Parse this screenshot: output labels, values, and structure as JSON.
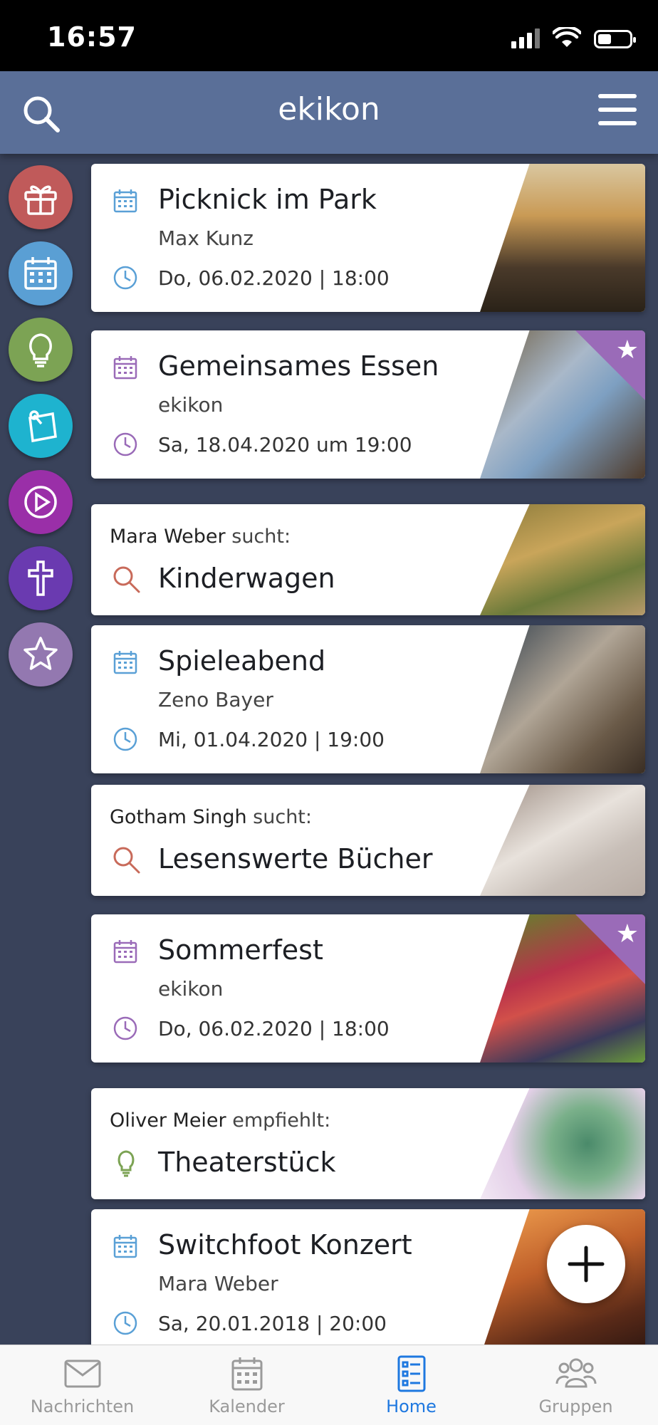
{
  "status_bar": {
    "time": "16:57"
  },
  "header": {
    "title": "ekikon"
  },
  "rail": [
    {
      "name": "gift",
      "color": "#c05a5a"
    },
    {
      "name": "calendar",
      "color": "#5a9fd4"
    },
    {
      "name": "idea",
      "color": "#7ca354"
    },
    {
      "name": "notes",
      "color": "#1eb3cf"
    },
    {
      "name": "video",
      "color": "#9a2fa8"
    },
    {
      "name": "faith",
      "color": "#6a3ab0"
    },
    {
      "name": "favorites",
      "color": "#9378b0"
    }
  ],
  "cards": {
    "c1": {
      "title": "Picknick im Park",
      "subtitle": "Max Kunz",
      "time": "Do, 06.02.2020 | 18:00",
      "accent": "#5aa0d6"
    },
    "c2": {
      "title": "Gemeinsames Essen",
      "subtitle": "ekikon",
      "time": "Sa, 18.04.2020 um 19:00",
      "accent": "#9a6bb8",
      "favorite": true
    },
    "c3": {
      "person": "Mara Weber",
      "verb": "sucht:",
      "title": "Kinderwagen",
      "accent": "#c86a5a"
    },
    "c4": {
      "title": "Spieleabend",
      "subtitle": "Zeno Bayer",
      "time": "Mi, 01.04.2020 | 19:00",
      "accent": "#5aa0d6"
    },
    "c5": {
      "person": "Gotham Singh",
      "verb": "sucht:",
      "title": "Lesenswerte Bücher",
      "accent": "#c86a5a"
    },
    "c6": {
      "title": "Sommerfest",
      "subtitle": "ekikon",
      "time": "Do, 06.02.2020 | 18:00",
      "accent": "#9a6bb8",
      "favorite": true
    },
    "c7": {
      "person": "Oliver Meier",
      "verb": "empfiehlt:",
      "title": "Theaterstück",
      "accent": "#7ca354"
    },
    "c8": {
      "title": "Switchfoot Konzert",
      "subtitle": "Mara Weber",
      "time": "Sa, 20.01.2018 | 20:00",
      "accent": "#5aa0d6"
    }
  },
  "bottom_nav": {
    "messages": "Nachrichten",
    "calendar": "Kalender",
    "home": "Home",
    "groups": "Gruppen",
    "active": "home"
  },
  "colors": {
    "header": "#5a6f98",
    "background": "#39425a",
    "active_tab": "#1e78e0"
  }
}
